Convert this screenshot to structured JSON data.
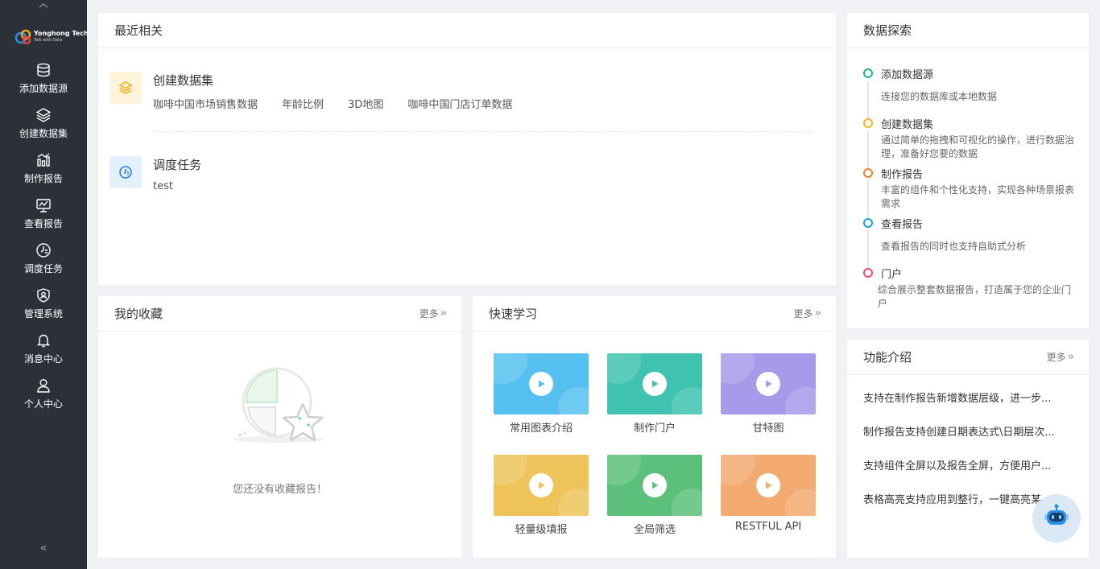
{
  "brand": {
    "name": "Yonghong Tech",
    "slogan": "Talk with Data"
  },
  "sidebar": {
    "items": [
      {
        "label": "添加数据源",
        "icon": "database-icon"
      },
      {
        "label": "创建数据集",
        "icon": "layers-icon"
      },
      {
        "label": "制作报告",
        "icon": "bar-chart-icon"
      },
      {
        "label": "查看报告",
        "icon": "monitor-chart-icon"
      },
      {
        "label": "调度任务",
        "icon": "clock-task-icon"
      },
      {
        "label": "管理系统",
        "icon": "shield-user-icon"
      },
      {
        "label": "消息中心",
        "icon": "bell-icon"
      },
      {
        "label": "个人中心",
        "icon": "user-icon"
      }
    ],
    "collapse_label": "«"
  },
  "recent": {
    "title": "最近相关",
    "groups": [
      {
        "title": "创建数据集",
        "icon": "dataset-layers-icon",
        "items": [
          "咖啡中国市场销售数据",
          "年龄比例",
          "3D地图",
          "咖啡中国门店订单数据"
        ]
      },
      {
        "title": "调度任务",
        "icon": "schedule-clock-icon",
        "items": [
          "test"
        ]
      }
    ]
  },
  "favorites": {
    "title": "我的收藏",
    "more": "更多",
    "empty_text": "您还没有收藏报告！"
  },
  "quick_learn": {
    "title": "快速学习",
    "more": "更多",
    "tiles": [
      {
        "label": "常用图表介绍",
        "color": "#56c1f0"
      },
      {
        "label": "制作门户",
        "color": "#3fc3b0"
      },
      {
        "label": "甘特图",
        "color": "#a999ea"
      },
      {
        "label": "轻量级填报",
        "color": "#eec35a"
      },
      {
        "label": "全局筛选",
        "color": "#5cc07a"
      },
      {
        "label": "RESTFUL API",
        "color": "#f3aa70"
      }
    ]
  },
  "explore": {
    "title": "数据探索",
    "steps": [
      {
        "title": "添加数据源",
        "desc": "连接您的数据库或本地数据",
        "color": "#1fb38a"
      },
      {
        "title": "创建数据集",
        "desc": "通过简单的拖拽和可视化的操作，进行数据治理，准备好您要的数据",
        "color": "#f5b622"
      },
      {
        "title": "制作报告",
        "desc": "丰富的组件和个性化支持，实现各种场景报表需求",
        "color": "#f57c2a"
      },
      {
        "title": "查看报告",
        "desc": "查看报告的同时也支持自助式分析",
        "color": "#1aa3d9"
      },
      {
        "title": "门户",
        "desc": "综合展示整套数据报告，打造属于您的企业门户",
        "color": "#ea4f6a"
      }
    ]
  },
  "features": {
    "title": "功能介绍",
    "more": "更多",
    "items": [
      "支持在制作报告新增数据层级，进一步...",
      "制作报告支持创建日期表达式\\日期层次...",
      "支持组件全屏以及报告全屏，方便用户...",
      "表格高亮支持应用到整行，一键高亮某"
    ]
  }
}
